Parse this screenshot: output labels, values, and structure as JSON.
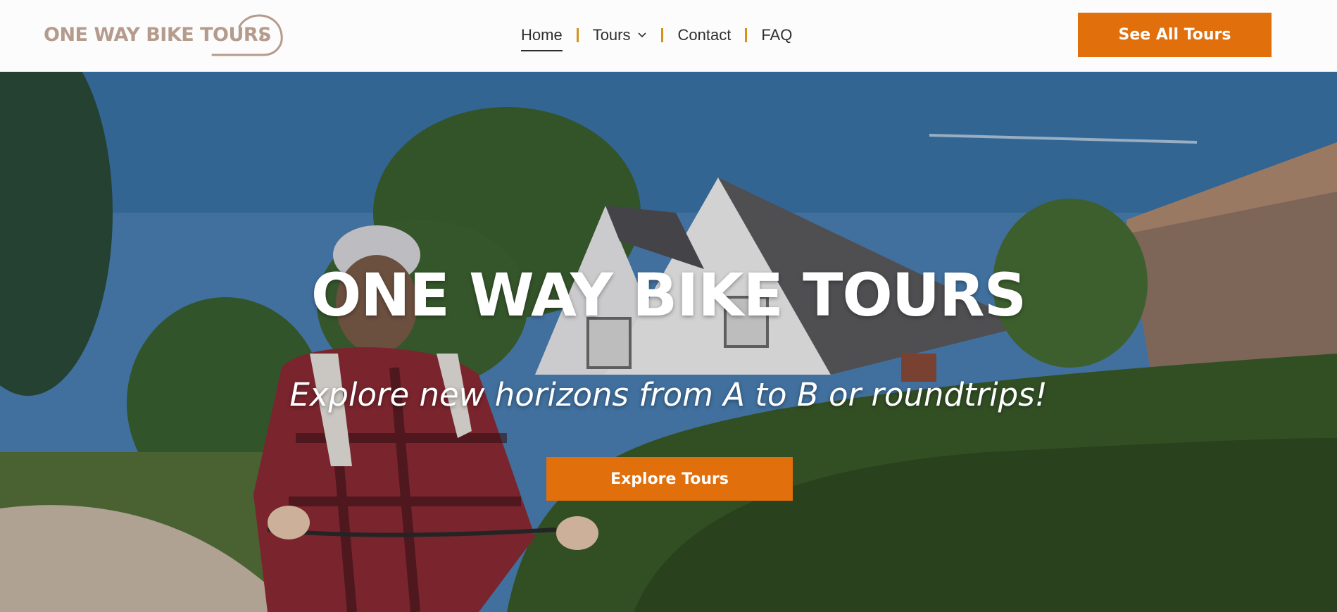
{
  "brand": {
    "logo_text": "ONE WAY BIKE TOURS",
    "logo_color": "#b59b8c"
  },
  "nav": {
    "items": [
      {
        "label": "Home",
        "active": true
      },
      {
        "label": "Tours",
        "has_dropdown": true
      },
      {
        "label": "Contact"
      },
      {
        "label": "FAQ"
      }
    ],
    "separator_color": "#d4921a"
  },
  "header": {
    "cta_label": "See All Tours"
  },
  "hero": {
    "title": "ONE WAY BIKE TOURS",
    "subtitle": "Explore new horizons from A to B or roundtrips!",
    "cta_label": "Explore Tours",
    "background": "cyclist-riding-past-white-house-video"
  },
  "colors": {
    "accent": "#e06f0c",
    "nav_text": "#2e2e2e",
    "hero_text": "#ffffff"
  }
}
